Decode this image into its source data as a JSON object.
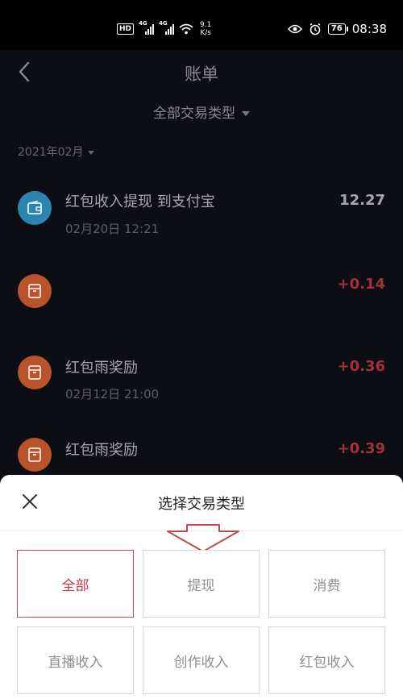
{
  "status_bar": {
    "hd_label": "HD",
    "network_1": "4G",
    "network_2": "4G",
    "speed_value": "9.1",
    "speed_unit": "K/s",
    "battery": "76",
    "time": "08:38"
  },
  "header": {
    "title": "账单",
    "filter_label": "全部交易类型",
    "month_label": "2021年02月"
  },
  "transactions": [
    {
      "title": "红包收入提现 到支付宝",
      "time": "02月20日 12:21",
      "amount": "12.27",
      "icon": "wallet-icon",
      "color": "#2a86b0"
    },
    {
      "title": "",
      "time": "",
      "amount": "+0.14",
      "icon": "box-icon",
      "color": "#b8532c"
    },
    {
      "title": "红包雨奖励",
      "time": "02月12日 21:00",
      "amount": "+0.36",
      "icon": "box-icon",
      "color": "#b8532c"
    },
    {
      "title": "红包雨奖励",
      "time": "",
      "amount": "+0.39",
      "icon": "box-icon",
      "color": "#b8532c"
    }
  ],
  "sheet": {
    "title": "选择交易类型",
    "options": [
      "全部",
      "提现",
      "消费",
      "直播收入",
      "创作收入",
      "红包收入"
    ],
    "selected": "全部",
    "accent_color": "#d34455"
  }
}
